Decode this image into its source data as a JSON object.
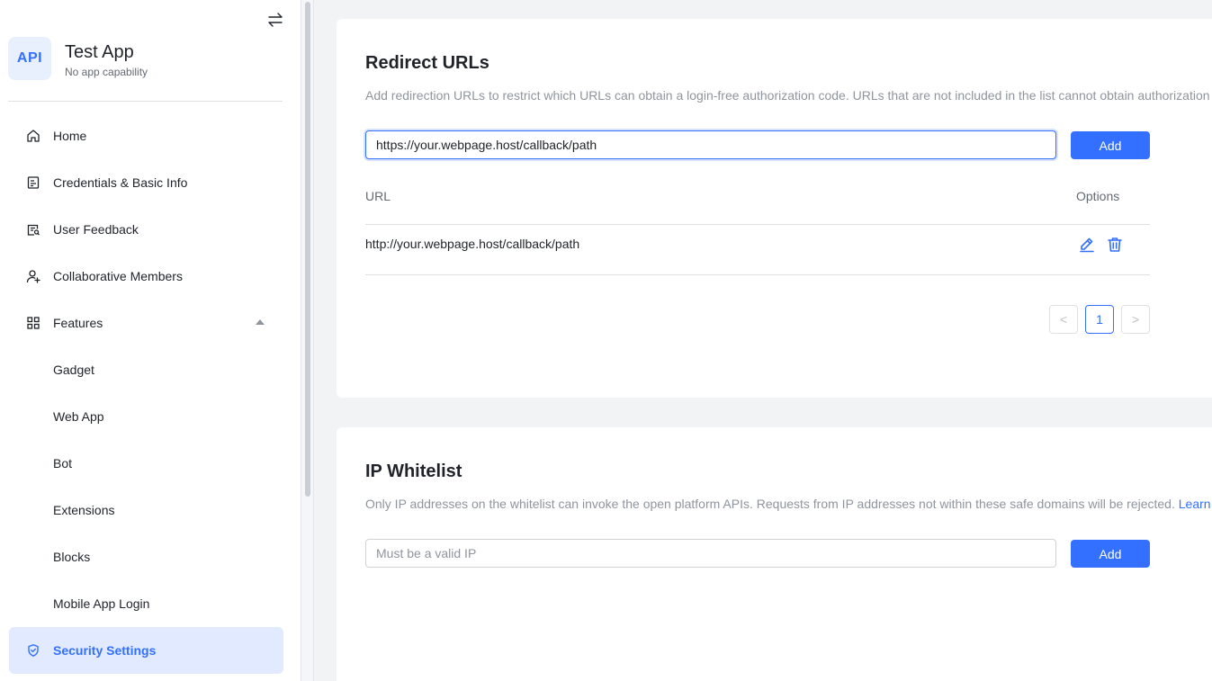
{
  "app": {
    "logo_text": "API",
    "name": "Test App",
    "subtitle": "No app capability"
  },
  "sidebar": {
    "items": [
      {
        "label": "Home",
        "icon": "home-icon"
      },
      {
        "label": "Credentials & Basic Info",
        "icon": "credentials-icon"
      },
      {
        "label": "User Feedback",
        "icon": "feedback-icon"
      },
      {
        "label": "Collaborative Members",
        "icon": "members-icon"
      },
      {
        "label": "Features",
        "icon": "grid-icon",
        "expanded": true
      },
      {
        "label": "Gadget"
      },
      {
        "label": "Web App"
      },
      {
        "label": "Bot"
      },
      {
        "label": "Extensions"
      },
      {
        "label": "Blocks"
      },
      {
        "label": "Mobile App Login"
      },
      {
        "label": "Security Settings",
        "icon": "shield-icon",
        "active": true
      }
    ]
  },
  "redirect": {
    "title": "Redirect URLs",
    "description": "Add redirection URLs to restrict which URLs can obtain a login-free authorization code. URLs that are not included in the list cannot obtain authorization",
    "input_value": "https://your.webpage.host/callback/path",
    "add_label": "Add",
    "col_url": "URL",
    "col_options": "Options",
    "rows": [
      {
        "url": "http://your.webpage.host/callback/path"
      }
    ],
    "pagination": {
      "prev": "<",
      "current": "1",
      "next": ">"
    }
  },
  "ip_whitelist": {
    "title": "IP Whitelist",
    "description": "Only IP addresses on the whitelist can invoke the open platform APIs. Requests from IP addresses not within these safe domains will be rejected.",
    "link_text": "Learn",
    "input_placeholder": "Must be a valid IP",
    "add_label": "Add"
  },
  "colors": {
    "accent": "#3370ff",
    "active_bg": "#e1eaff"
  }
}
